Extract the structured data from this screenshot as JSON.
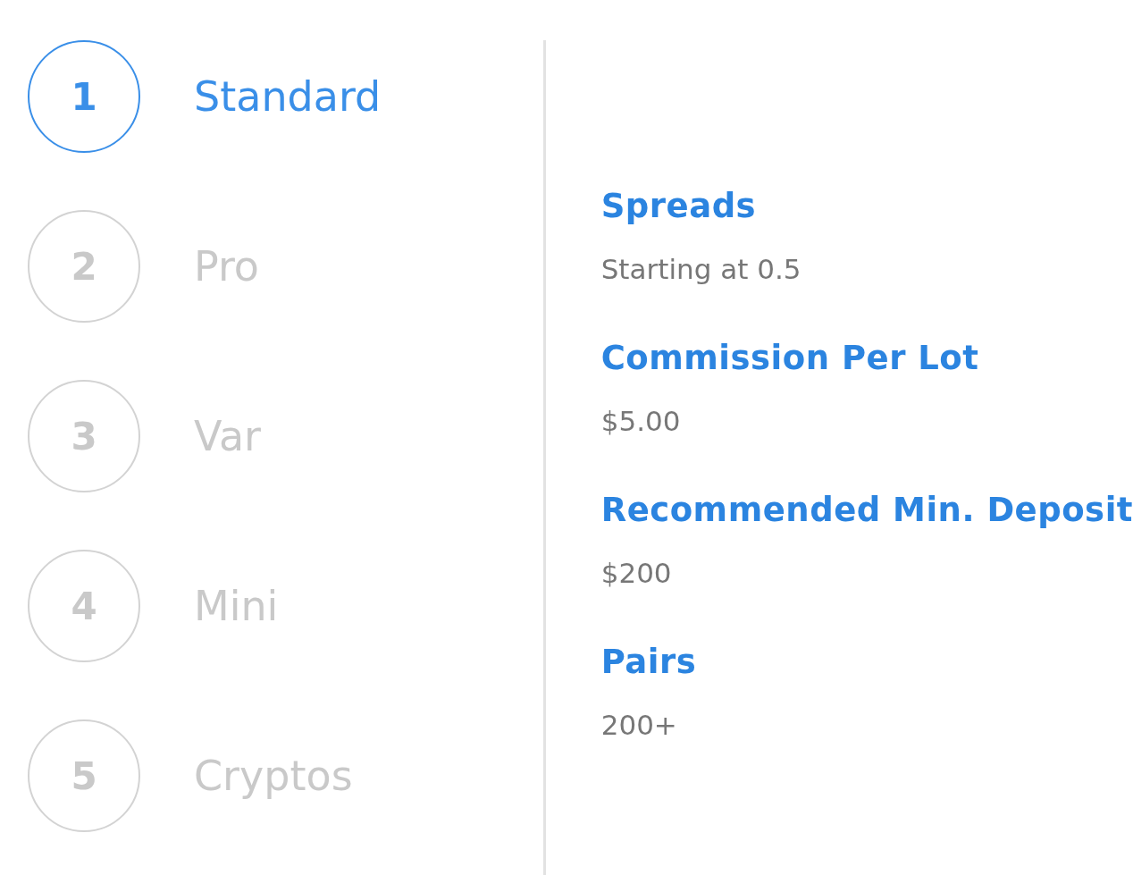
{
  "accounts": [
    {
      "number": "1",
      "name": "Standard",
      "selected": true
    },
    {
      "number": "2",
      "name": "Pro",
      "selected": false
    },
    {
      "number": "3",
      "name": "Var",
      "selected": false
    },
    {
      "number": "4",
      "name": "Mini",
      "selected": false
    },
    {
      "number": "5",
      "name": "Cryptos",
      "selected": false
    }
  ],
  "details": [
    {
      "label": "Spreads",
      "value": "Starting at 0.5"
    },
    {
      "label": "Commission Per Lot",
      "value": "$5.00"
    },
    {
      "label": "Recommended Min. Deposit",
      "value": "$200"
    },
    {
      "label": "Pairs",
      "value": "200+"
    }
  ]
}
